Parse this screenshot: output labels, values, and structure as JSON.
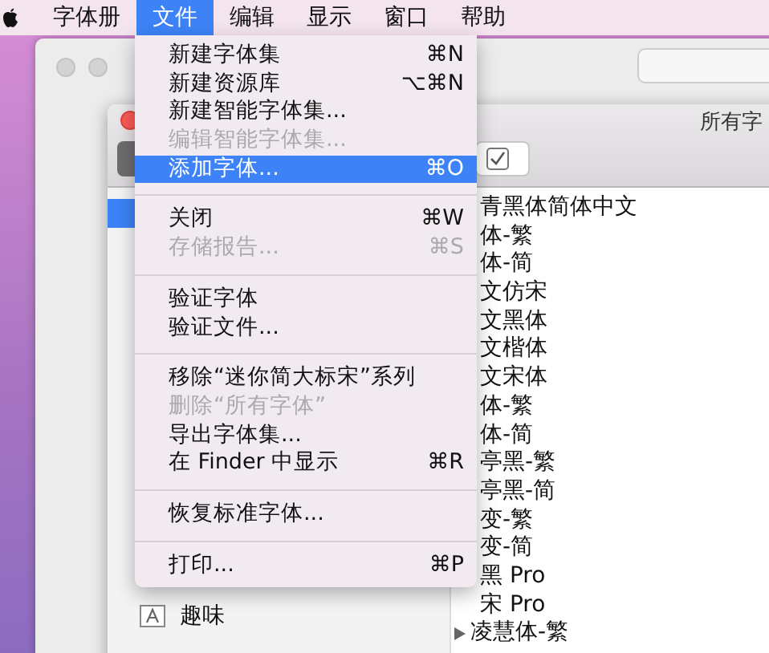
{
  "menu_bar": {
    "items": [
      {
        "label": "字体册",
        "selected": false
      },
      {
        "label": "文件",
        "selected": true
      },
      {
        "label": "编辑",
        "selected": false
      },
      {
        "label": "显示",
        "selected": false
      },
      {
        "label": "窗口",
        "selected": false
      },
      {
        "label": "帮助",
        "selected": false
      }
    ]
  },
  "file_menu": {
    "items": [
      {
        "kind": "item",
        "label": "新建字体集",
        "shortcut": "⌘N",
        "disabled": false,
        "selected": false
      },
      {
        "kind": "item",
        "label": "新建资源库",
        "shortcut": "⌥⌘N",
        "disabled": false,
        "selected": false
      },
      {
        "kind": "item",
        "label": "新建智能字体集...",
        "disabled": false,
        "selected": false
      },
      {
        "kind": "item",
        "label": "编辑智能字体集...",
        "disabled": true,
        "selected": false
      },
      {
        "kind": "item",
        "label": "添加字体...",
        "shortcut": "⌘O",
        "disabled": false,
        "selected": true
      },
      {
        "kind": "separator"
      },
      {
        "kind": "item",
        "label": "关闭",
        "shortcut": "⌘W",
        "disabled": false,
        "selected": false
      },
      {
        "kind": "item",
        "label": "存储报告...",
        "shortcut": "⌘S",
        "disabled": true,
        "selected": false
      },
      {
        "kind": "separator"
      },
      {
        "kind": "item",
        "label": "验证字体",
        "disabled": false,
        "selected": false
      },
      {
        "kind": "item",
        "label": "验证文件...",
        "disabled": false,
        "selected": false
      },
      {
        "kind": "separator"
      },
      {
        "kind": "item",
        "label": "移除“迷你简大标宋”系列",
        "disabled": false,
        "selected": false
      },
      {
        "kind": "item",
        "label": "删除“所有字体”",
        "disabled": true,
        "selected": false
      },
      {
        "kind": "item",
        "label": "导出字体集...",
        "disabled": false,
        "selected": false
      },
      {
        "kind": "item",
        "label": "在 Finder 中显示",
        "shortcut": "⌘R",
        "disabled": false,
        "selected": false
      },
      {
        "kind": "separator"
      },
      {
        "kind": "item",
        "label": "恢复标准字体...",
        "disabled": false,
        "selected": false
      },
      {
        "kind": "separator"
      },
      {
        "kind": "item",
        "label": "打印...",
        "shortcut": "⌘P",
        "disabled": false,
        "selected": false
      }
    ]
  },
  "window": {
    "title": "所有字",
    "sidebar": {
      "rows": [
        {
          "kind": "item",
          "selected": true
        },
        {
          "kind": "collection",
          "label": "趣味",
          "selected": false
        }
      ]
    },
    "font_list": [
      {
        "kind": "font",
        "label": "青黑体简体中文"
      },
      {
        "kind": "font",
        "label": "体-繁"
      },
      {
        "kind": "font",
        "label": "体-简"
      },
      {
        "kind": "font",
        "label": "文仿宋"
      },
      {
        "kind": "font",
        "label": "文黑体"
      },
      {
        "kind": "font",
        "label": "文楷体"
      },
      {
        "kind": "font",
        "label": "文宋体"
      },
      {
        "kind": "font",
        "label": "体-繁"
      },
      {
        "kind": "font",
        "label": "体-简"
      },
      {
        "kind": "font",
        "label": "亭黑-繁"
      },
      {
        "kind": "font",
        "label": "亭黑-简"
      },
      {
        "kind": "font",
        "label": "变-繁"
      },
      {
        "kind": "font",
        "label": "变-简"
      },
      {
        "kind": "font",
        "label": "黑 Pro"
      },
      {
        "kind": "font",
        "label": "宋 Pro"
      },
      {
        "kind": "family",
        "label": "凌慧体-繁",
        "expanded": false
      }
    ]
  }
}
